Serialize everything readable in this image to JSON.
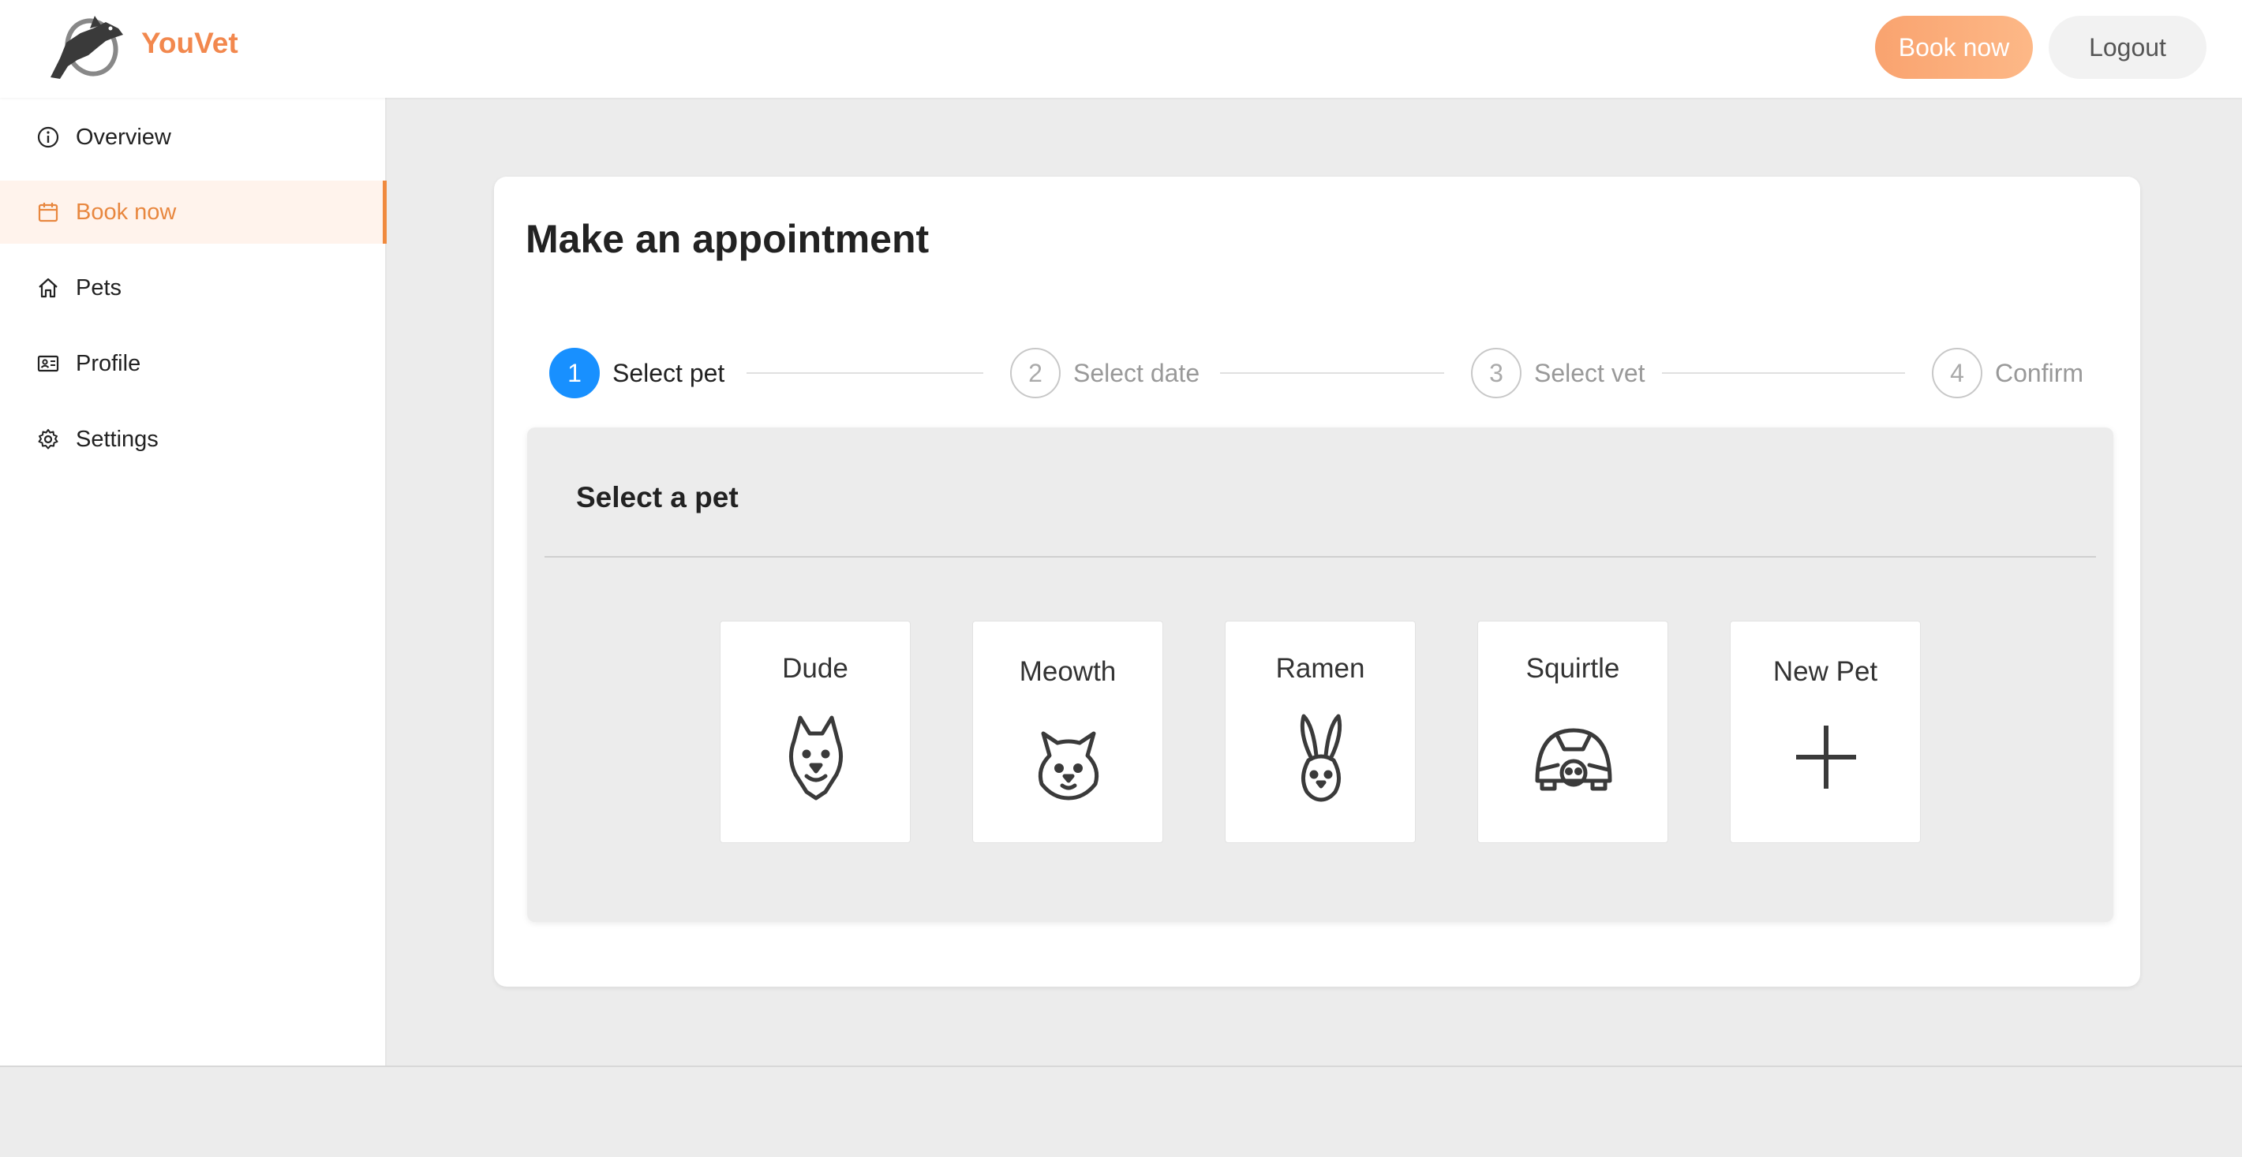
{
  "app": {
    "brand": "YouVet"
  },
  "header": {
    "book_label": "Book now",
    "logout_label": "Logout"
  },
  "sidebar": {
    "items": [
      {
        "label": "Overview",
        "icon": "info-circle-icon"
      },
      {
        "label": "Book now",
        "icon": "calendar-icon",
        "active": true
      },
      {
        "label": "Pets",
        "icon": "home-icon"
      },
      {
        "label": "Profile",
        "icon": "id-card-icon"
      },
      {
        "label": "Settings",
        "icon": "gear-icon"
      }
    ]
  },
  "main": {
    "title": "Make an appointment",
    "steps": [
      {
        "number": "1",
        "label": "Select pet",
        "active": true
      },
      {
        "number": "2",
        "label": "Select date"
      },
      {
        "number": "3",
        "label": "Select vet"
      },
      {
        "number": "4",
        "label": "Confirm"
      }
    ],
    "panel": {
      "title": "Select a pet",
      "pets": [
        {
          "name": "Dude",
          "icon": "dog-icon"
        },
        {
          "name": "Meowth",
          "icon": "cat-icon"
        },
        {
          "name": "Ramen",
          "icon": "rabbit-icon"
        },
        {
          "name": "Squirtle",
          "icon": "turtle-icon"
        },
        {
          "name": "New Pet",
          "icon": "plus-icon"
        }
      ]
    }
  },
  "colors": {
    "accent": "#f2884e",
    "active_step": "#1890ff",
    "background": "#ececec"
  }
}
